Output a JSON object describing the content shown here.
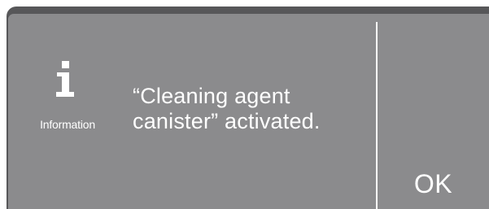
{
  "dialog": {
    "icon_name": "info-icon",
    "icon_caption": "Information",
    "message_line1": "“Cleaning agent",
    "message_line2": "canister” activated.",
    "ok_label": "OK"
  },
  "colors": {
    "bezel": "#575759",
    "screen": "#8b8b8d",
    "text": "#ffffff"
  }
}
